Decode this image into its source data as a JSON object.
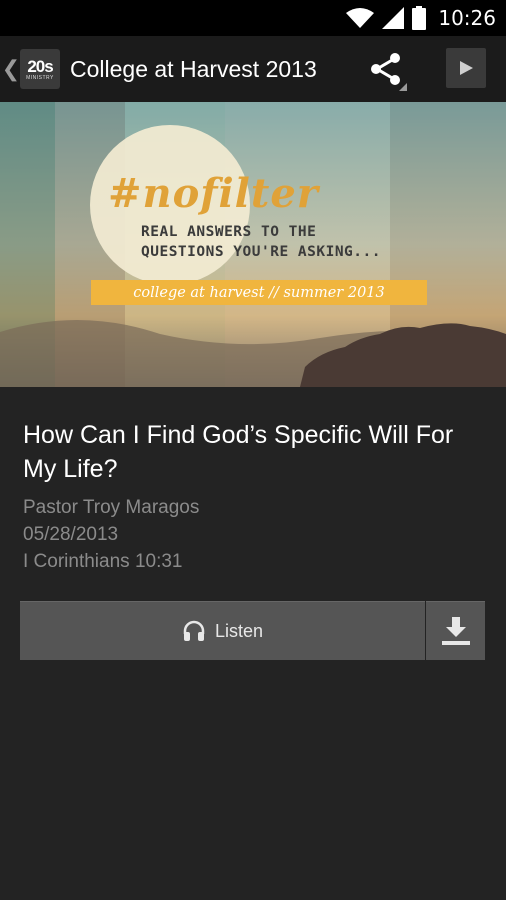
{
  "status_bar": {
    "time": "10:26",
    "icons": [
      "wifi-icon",
      "cell-signal-icon",
      "battery-icon"
    ]
  },
  "action_bar": {
    "up_glyph": "❮",
    "logo_text": "20s",
    "logo_subtext": "MINISTRY",
    "title": "College at Harvest 2013",
    "share_icon": "share-icon",
    "play_icon": "play-icon"
  },
  "banner": {
    "hashtag": "#nofilter",
    "tagline_line1": "REAL ANSWERS TO THE",
    "tagline_line2": "QUESTIONS YOU'RE ASKING...",
    "ribbon": "college at harvest // summer 2013"
  },
  "sermon": {
    "title": "How Can I Find God’s Specific Will For My Life?",
    "speaker": "Pastor Troy Maragos",
    "date": "05/28/2013",
    "scripture": "I Corinthians 10:31"
  },
  "actions": {
    "listen_label": "Listen",
    "listen_icon": "headphones-icon",
    "download_icon": "download-icon"
  },
  "colors": {
    "background": "#232323",
    "action_bar": "#1b1b1b",
    "button": "#555555",
    "accent_orange": "#f0b53e"
  }
}
